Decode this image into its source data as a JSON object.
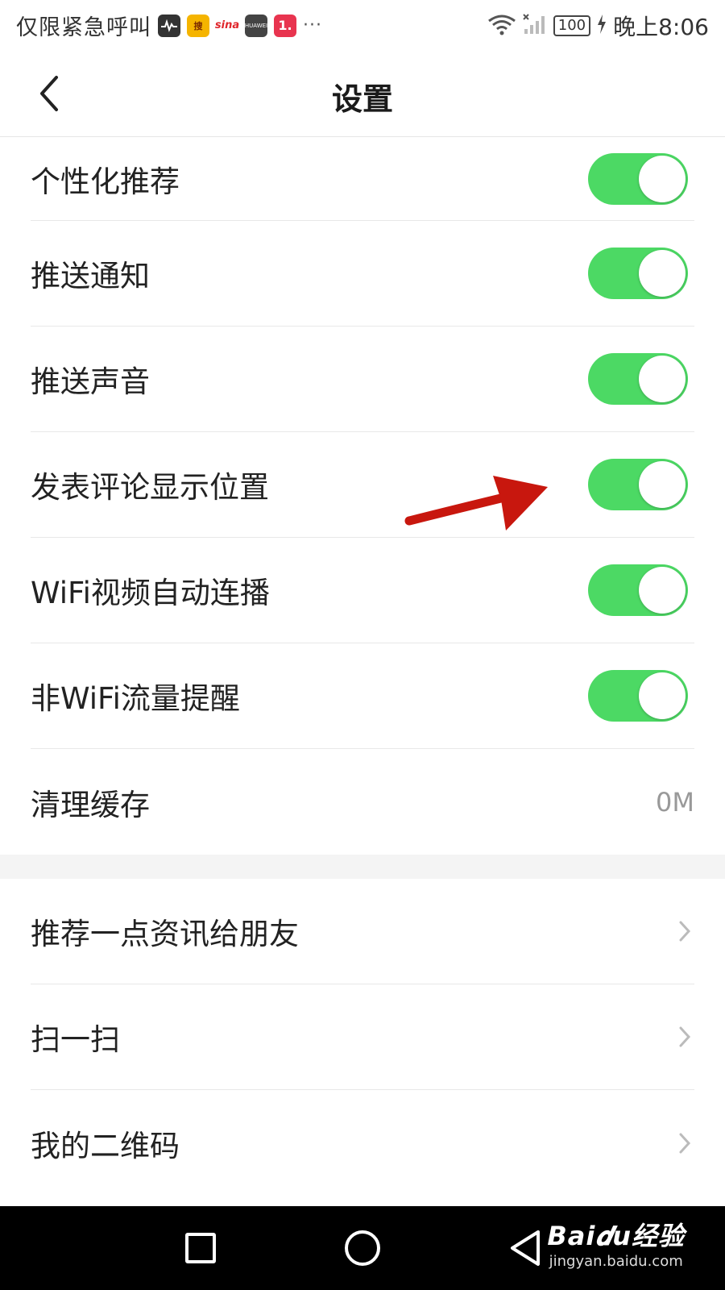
{
  "status_bar": {
    "carrier_text": "仅限紧急呼叫",
    "app_icons": [
      "pulse-app-icon",
      "sogou-app-icon",
      "sina-app-icon",
      "huawei-app-icon",
      "one-app-icon"
    ],
    "sogou_label": "搜",
    "sina_label": "sina",
    "huawei_label": "HUAWEI",
    "one_label": "1.",
    "more_dots": "···",
    "battery": "100",
    "time": "晚上8:06"
  },
  "header": {
    "title": "设置"
  },
  "settings": {
    "personalized": {
      "label": "个性化推荐",
      "on": true
    },
    "push_notify": {
      "label": "推送通知",
      "on": true
    },
    "push_sound": {
      "label": "推送声音",
      "on": true
    },
    "comment_location": {
      "label": "发表评论显示位置",
      "on": true
    },
    "wifi_autoplay": {
      "label": "WiFi视频自动连播",
      "on": true
    },
    "data_alert": {
      "label": "非WiFi流量提醒",
      "on": true
    },
    "clear_cache": {
      "label": "清理缓存",
      "value": "0M"
    }
  },
  "more": {
    "recommend": "推荐一点资讯给朋友",
    "scan": "扫一扫",
    "qrcode": "我的二维码"
  },
  "watermark": {
    "main": "Bai𝒅u经验",
    "sub": "jingyan.baidu.com"
  },
  "colors": {
    "toggle_on": "#4cd964",
    "annotation_arrow": "#c8170e"
  }
}
